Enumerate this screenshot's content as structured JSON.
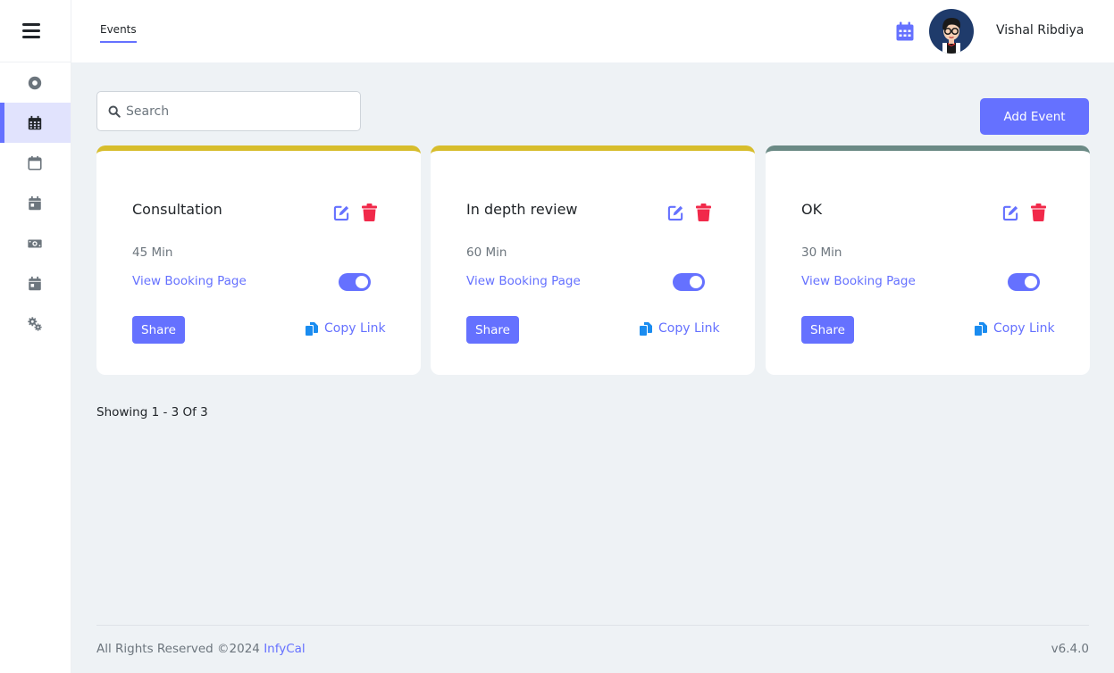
{
  "header": {
    "tabs": [
      {
        "label": "Events",
        "active": true
      }
    ],
    "user_name": "Vishal Ribdiya"
  },
  "sidebar": {
    "items": [
      {
        "icon": "dashboard-icon",
        "active": false
      },
      {
        "icon": "calendar-grid-icon",
        "active": true
      },
      {
        "icon": "calendar-outline-icon",
        "active": false
      },
      {
        "icon": "calendar-day-icon",
        "active": false
      },
      {
        "icon": "money-bill-icon",
        "active": false
      },
      {
        "icon": "calendar-day-icon",
        "active": false
      },
      {
        "icon": "gears-icon",
        "active": false
      }
    ]
  },
  "search": {
    "placeholder": "Search",
    "value": ""
  },
  "toolbar": {
    "add_label": "Add Event"
  },
  "events": [
    {
      "title": "Consultation",
      "duration": "45 Min",
      "view_label": "View Booking Page",
      "enabled": true,
      "share_label": "Share",
      "copy_label": "Copy Link",
      "accent": "#d7bd2c"
    },
    {
      "title": "In depth review",
      "duration": "60 Min",
      "view_label": "View Booking Page",
      "enabled": true,
      "share_label": "Share",
      "copy_label": "Copy Link",
      "accent": "#d7bd2c"
    },
    {
      "title": "OK",
      "duration": "30 Min",
      "view_label": "View Booking Page",
      "enabled": true,
      "share_label": "Share",
      "copy_label": "Copy Link",
      "accent": "#6b8a85"
    }
  ],
  "pagination": {
    "text": "Showing 1 - 3 Of 3"
  },
  "footer": {
    "copyright": "All Rights Reserved ©2024 ",
    "brand": "InfyCal",
    "version": "v6.4.0"
  },
  "colors": {
    "primary": "#6571ff",
    "danger": "#f1294a",
    "copy": "#1a8cf0"
  }
}
